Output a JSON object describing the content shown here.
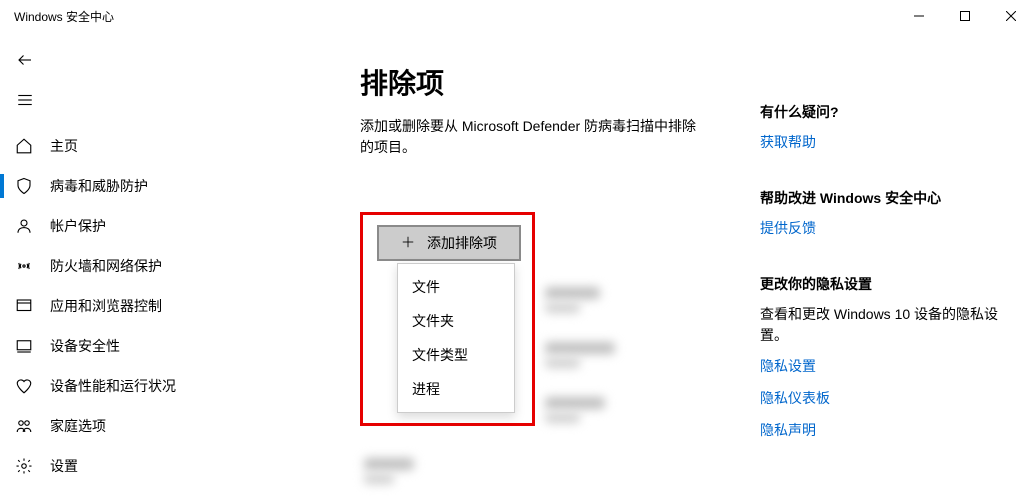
{
  "window": {
    "title": "Windows 安全中心"
  },
  "sidebar": {
    "items": [
      {
        "label": "主页",
        "icon": "home-icon"
      },
      {
        "label": "病毒和威胁防护",
        "icon": "shield-icon",
        "active": true
      },
      {
        "label": "帐户保护",
        "icon": "person-icon"
      },
      {
        "label": "防火墙和网络保护",
        "icon": "wifi-icon"
      },
      {
        "label": "应用和浏览器控制",
        "icon": "app-icon"
      },
      {
        "label": "设备安全性",
        "icon": "device-icon"
      },
      {
        "label": "设备性能和运行状况",
        "icon": "heart-icon"
      },
      {
        "label": "家庭选项",
        "icon": "family-icon"
      },
      {
        "label": "设置",
        "icon": "gear-icon"
      }
    ]
  },
  "main": {
    "title": "排除项",
    "description": "添加或删除要从 Microsoft Defender 防病毒扫描中排除的项目。",
    "add_button": "添加排除项",
    "dropdown": [
      "文件",
      "文件夹",
      "文件类型",
      "进程"
    ]
  },
  "side": {
    "help": {
      "heading": "有什么疑问?",
      "link": "获取帮助"
    },
    "feedback": {
      "heading": "帮助改进 Windows 安全中心",
      "link": "提供反馈"
    },
    "privacy": {
      "heading": "更改你的隐私设置",
      "text": "查看和更改 Windows 10 设备的隐私设置。",
      "links": [
        "隐私设置",
        "隐私仪表板",
        "隐私声明"
      ]
    }
  }
}
